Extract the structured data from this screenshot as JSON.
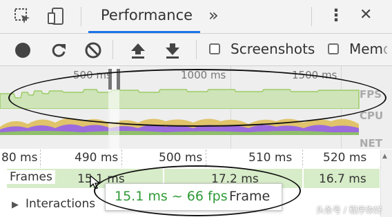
{
  "tabbar": {
    "tab_label": "Performance",
    "more_tabs": "»",
    "menu_glyph": "⋮",
    "close_glyph": "✕"
  },
  "toolbar": {
    "screenshots_label": "Screenshots",
    "memory_label": "Mem",
    "memory_fade": "ory"
  },
  "overview": {
    "ruler": [
      "500 ms",
      "1000 ms",
      "1500 ms"
    ],
    "lanes": {
      "fps": "FPS",
      "cpu": "CPU",
      "net": "NET"
    }
  },
  "timeline": {
    "ticks": [
      "80 ms",
      "490 ms",
      "500 ms",
      "510 ms",
      "520 ms"
    ]
  },
  "frames": {
    "track_label": "Frames",
    "frame1": "15.1 ms",
    "frame2": "17.2 ms",
    "frame3": "16.7 ms"
  },
  "interactions": {
    "label": "Interactions"
  },
  "tooltip": {
    "value": "15.1 ms ~ 66 fps",
    "label": "Frame"
  },
  "watermark": "头条号 / 程序你好",
  "colors": {
    "accent": "#1a73e8",
    "fps_green": "#9ccc65",
    "tooltip_green": "#2e9a36",
    "cpu_purple": "#9c6ade",
    "cpu_yellow": "#e0c36a"
  }
}
